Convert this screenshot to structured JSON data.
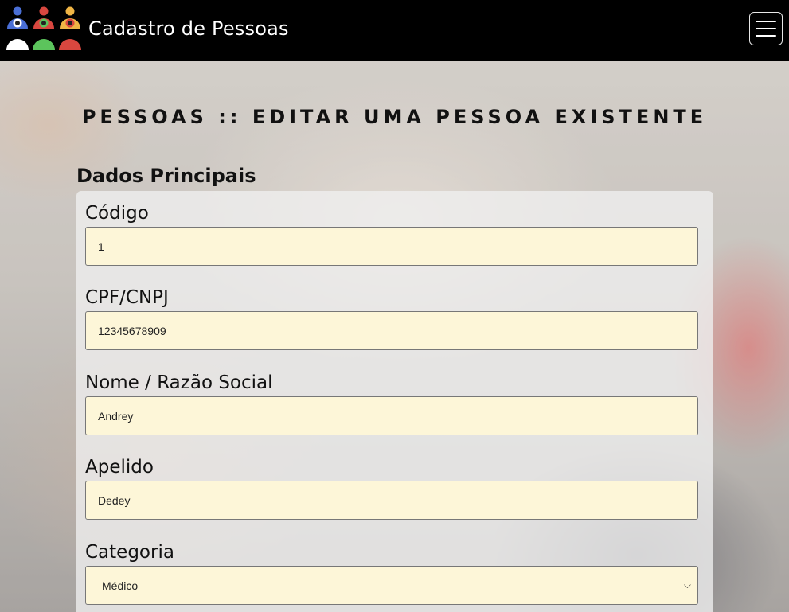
{
  "app": {
    "title": "Cadastro de Pessoas"
  },
  "header": {
    "menu_icon": "hamburger-icon",
    "logo_icon": "people-group-logo"
  },
  "page": {
    "title": "PESSOAS :: EDITAR UMA PESSOA EXISTENTE",
    "section_title": "Dados Principais"
  },
  "form": {
    "codigo": {
      "label": "Código",
      "value": "1"
    },
    "cpf": {
      "label": "CPF/CNPJ",
      "value": "12345678909"
    },
    "nome": {
      "label": "Nome / Razão Social",
      "value": "Andrey"
    },
    "apelido": {
      "label": "Apelido",
      "value": "Dedey"
    },
    "categoria": {
      "label": "Categoria",
      "value": "Médico"
    }
  },
  "colors": {
    "navbar": "#000000",
    "input_bg": "#fdf6d8",
    "logo_blue": "#4a6fd6",
    "logo_green": "#5cc45c",
    "logo_red": "#d9473f",
    "logo_orange": "#f0b545"
  }
}
